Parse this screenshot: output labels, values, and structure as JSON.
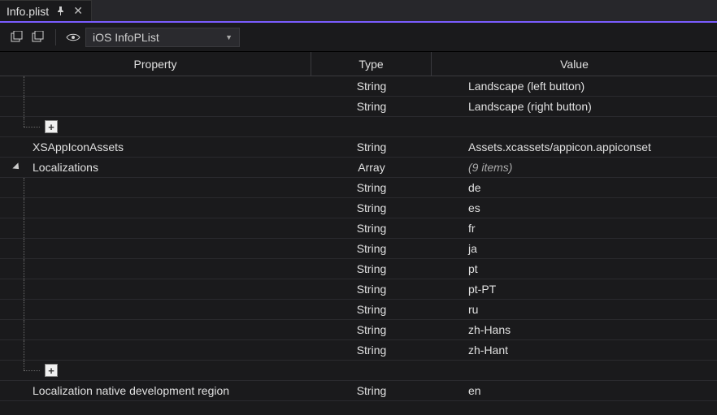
{
  "tab": {
    "title": "Info.plist"
  },
  "toolbar": {
    "scope_label": "iOS InfoPList"
  },
  "columns": {
    "property": "Property",
    "type": "Type",
    "value": "Value"
  },
  "rows": [
    {
      "kind": "child",
      "property": "",
      "type": "String",
      "value": "Landscape (left button)"
    },
    {
      "kind": "child",
      "property": "",
      "type": "String",
      "value": "Landscape (right button)"
    },
    {
      "kind": "add",
      "property": "",
      "type": "",
      "value": ""
    },
    {
      "kind": "top",
      "property": "XSAppIconAssets",
      "type": "String",
      "value": "Assets.xcassets/appicon.appiconset"
    },
    {
      "kind": "parent",
      "property": "Localizations",
      "type": "Array",
      "value": "(9 items)",
      "italic": true
    },
    {
      "kind": "child",
      "property": "",
      "type": "String",
      "value": "de"
    },
    {
      "kind": "child",
      "property": "",
      "type": "String",
      "value": "es"
    },
    {
      "kind": "child",
      "property": "",
      "type": "String",
      "value": "fr"
    },
    {
      "kind": "child",
      "property": "",
      "type": "String",
      "value": "ja"
    },
    {
      "kind": "child",
      "property": "",
      "type": "String",
      "value": "pt"
    },
    {
      "kind": "child",
      "property": "",
      "type": "String",
      "value": "pt-PT"
    },
    {
      "kind": "child",
      "property": "",
      "type": "String",
      "value": "ru"
    },
    {
      "kind": "child",
      "property": "",
      "type": "String",
      "value": "zh-Hans"
    },
    {
      "kind": "child",
      "property": "",
      "type": "String",
      "value": "zh-Hant"
    },
    {
      "kind": "add",
      "property": "",
      "type": "",
      "value": ""
    },
    {
      "kind": "top",
      "property": "Localization native development region",
      "type": "String",
      "value": "en"
    }
  ]
}
